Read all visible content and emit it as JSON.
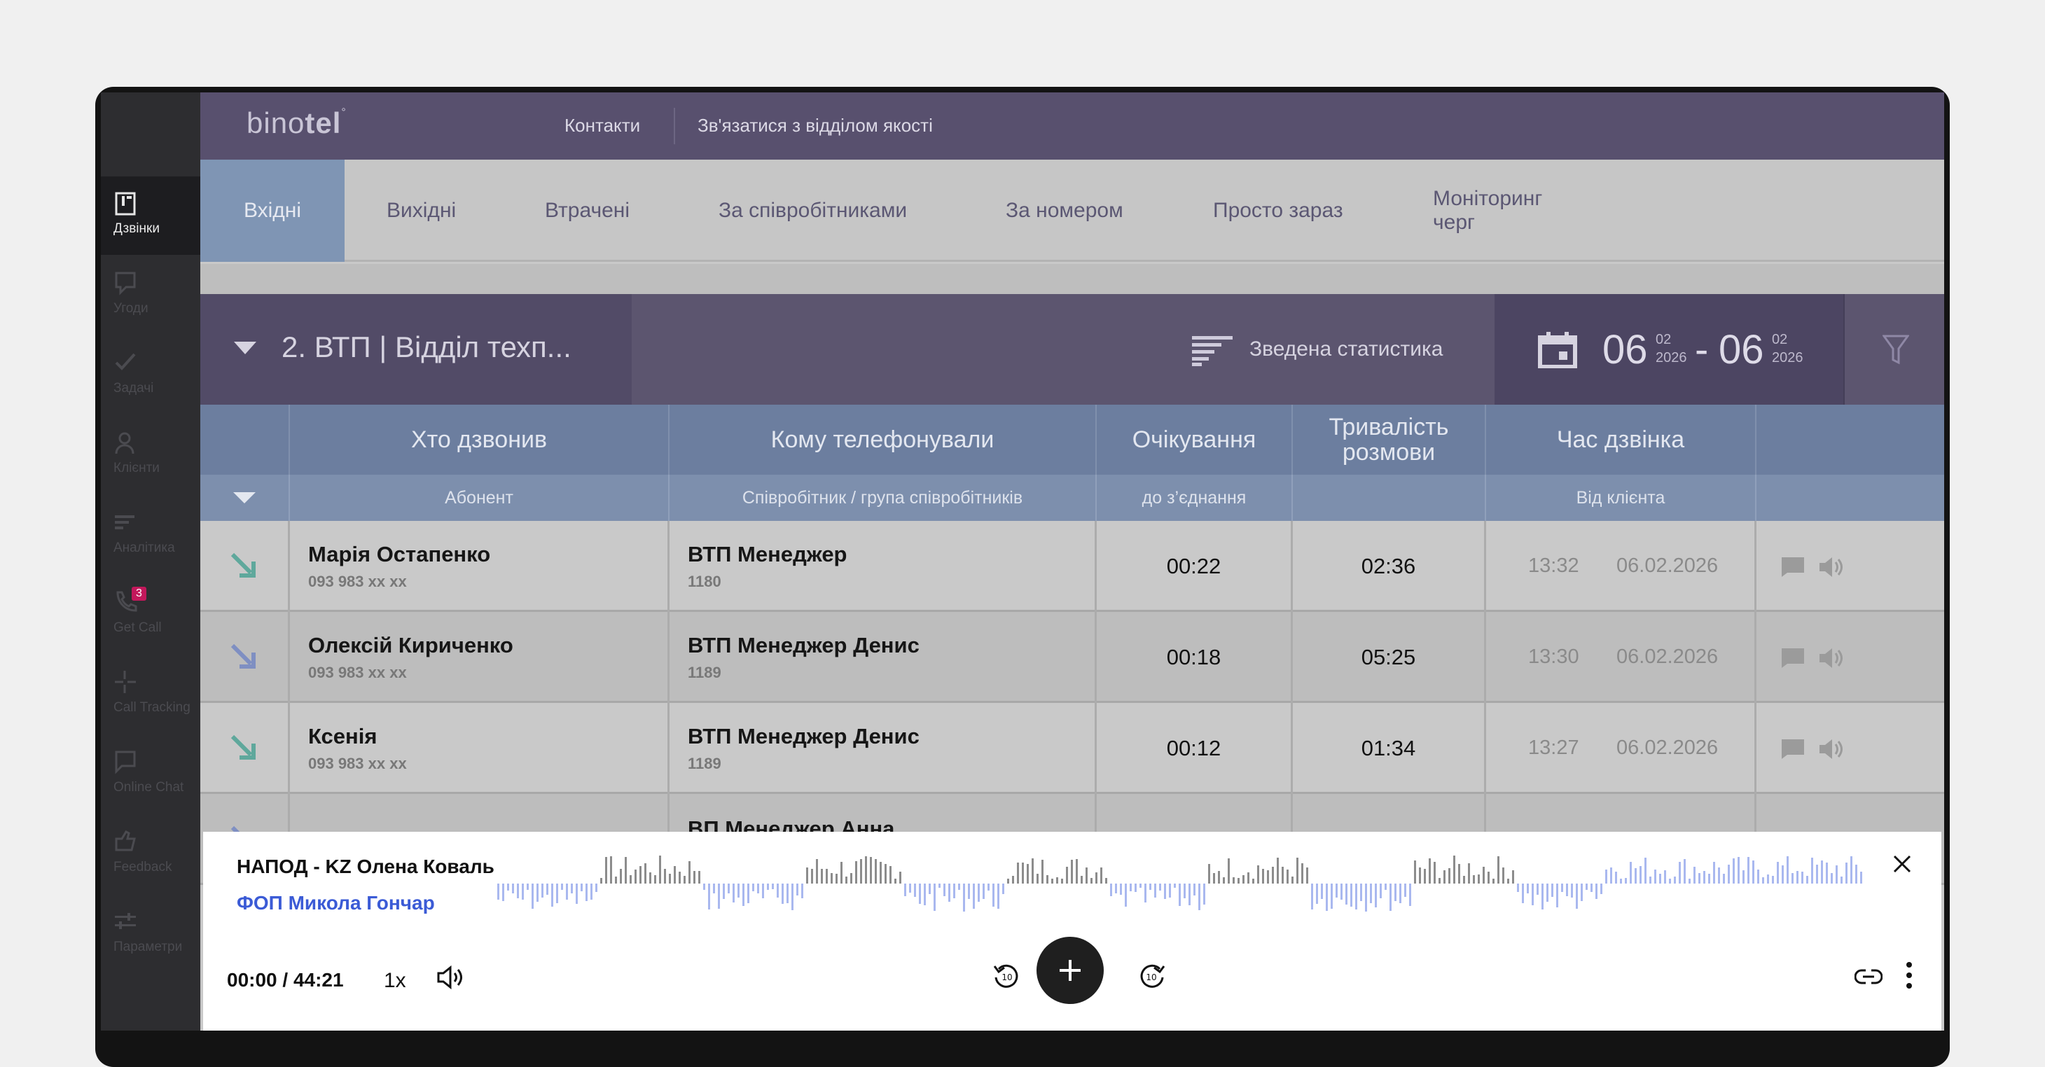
{
  "sidebar": {
    "items": [
      {
        "label": "Дзвінки",
        "icon": "calls-icon",
        "active": true
      },
      {
        "label": "Угоди",
        "icon": "deals-icon"
      },
      {
        "label": "Задачі",
        "icon": "tasks-icon"
      },
      {
        "label": "Клієнти",
        "icon": "clients-icon"
      },
      {
        "label": "Аналітика",
        "icon": "analytics-icon"
      },
      {
        "label": "Get Call",
        "icon": "getcall-icon",
        "badge": "3"
      },
      {
        "label": "Call Tracking",
        "icon": "calltracking-icon"
      },
      {
        "label": "Online Chat",
        "icon": "chat-icon"
      },
      {
        "label": "Feedback",
        "icon": "feedback-icon"
      },
      {
        "label": "Параметри",
        "icon": "settings-icon"
      }
    ]
  },
  "header": {
    "logo_light": "bino",
    "logo_bold": "tel",
    "links": [
      "Контакти",
      "Зв'язатися з відділом якості"
    ]
  },
  "tabs": [
    "Вхідні",
    "Вихідні",
    "Втрачені",
    "За співробітниками",
    "За номером",
    "Просто зараз",
    "Моніторинг черг"
  ],
  "filter": {
    "group_label": "2.  ВТП |  Відділ техп...",
    "stats_label": "Зведена статистика",
    "date_from_day": "06",
    "date_from_month": "02",
    "date_from_year": "2026",
    "date_sep": "-",
    "date_to_day": "06",
    "date_to_month": "02",
    "date_to_year": "2026"
  },
  "table": {
    "headers": [
      "Хто дзвонив",
      "Кому телефонували",
      "Очікування",
      "Тривалість розмови",
      "Час дзвінка"
    ],
    "subheaders": [
      "Абонент",
      "Співробітник / група співробітників",
      "до з’єднання",
      "",
      "Від клієнта"
    ],
    "rows": [
      {
        "caller": "Марія Остапенко",
        "caller_phone": "093 983 xx xx",
        "callee": "ВТП Менеджер",
        "callee_ext": "1180",
        "wait": "00:22",
        "duration": "02:36",
        "time": "13:32",
        "date": "06.02.2026"
      },
      {
        "caller": "Олексій Кириченко",
        "caller_phone": "093 983 xx xx",
        "callee": "ВТП Менеджер Денис",
        "callee_ext": "1189",
        "wait": "00:18",
        "duration": "05:25",
        "time": "13:30",
        "date": "06.02.2026"
      },
      {
        "caller": "Ксенія",
        "caller_phone": "093 983 xx xx",
        "callee": "ВТП Менеджер Денис",
        "callee_ext": "1189",
        "wait": "00:12",
        "duration": "01:34",
        "time": "13:27",
        "date": "06.02.2026"
      },
      {
        "caller": "",
        "caller_phone": "",
        "callee": "ВП Менеджер Анна",
        "callee_ext": "",
        "wait": "",
        "duration": "",
        "time": "",
        "date": ""
      }
    ]
  },
  "player": {
    "title": "НАПОД - KZ Олена Коваль",
    "subtitle": "ФОП Микола Гончар",
    "time": "00:00 / 44:21",
    "speed": "1x"
  },
  "colors": {
    "accent": "#3b5bd6",
    "header": "#58506e",
    "table_header": "#6c7e9f",
    "badge": "#c2185b"
  }
}
